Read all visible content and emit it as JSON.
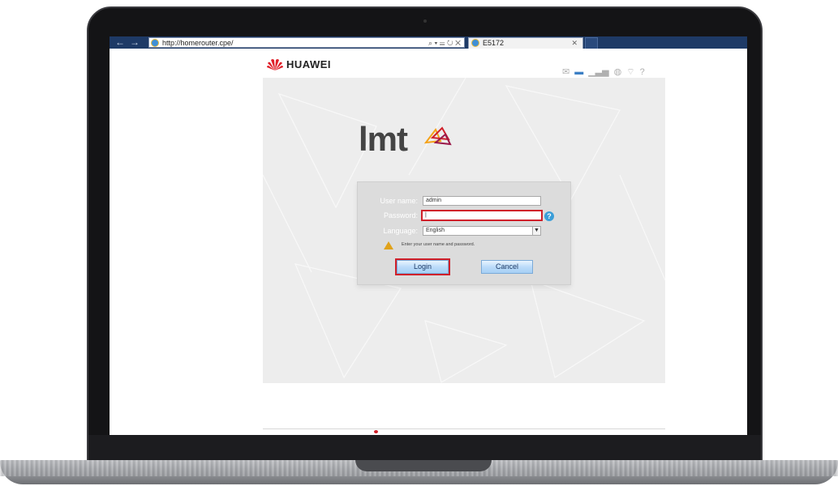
{
  "browser": {
    "address": "http://homerouter.cpe/",
    "address_tools": "⌕ ▾ ☰ ↻ ✕",
    "tab_title": "E5172",
    "tab_close": "✕",
    "back_icon": "←",
    "forward_icon": "→"
  },
  "header": {
    "brand": "HUAWEI",
    "status_icons": [
      "envelope-icon",
      "sim-icon",
      "signal-icon",
      "globe-icon",
      "wifi-icon",
      "help-icon"
    ]
  },
  "operator_logo": "lmt",
  "login": {
    "username_label": "User name:",
    "username_value": "admin",
    "password_label": "Password:",
    "password_value": "|",
    "language_label": "Language:",
    "language_value": "English",
    "hint": "Enter your user name and password.",
    "help": "?",
    "login_button": "Login",
    "cancel_button": "Cancel"
  },
  "colors": {
    "accent_red": "#d0202a",
    "browser_blue": "#1e3a66",
    "button_blue": "#a6cff4"
  }
}
